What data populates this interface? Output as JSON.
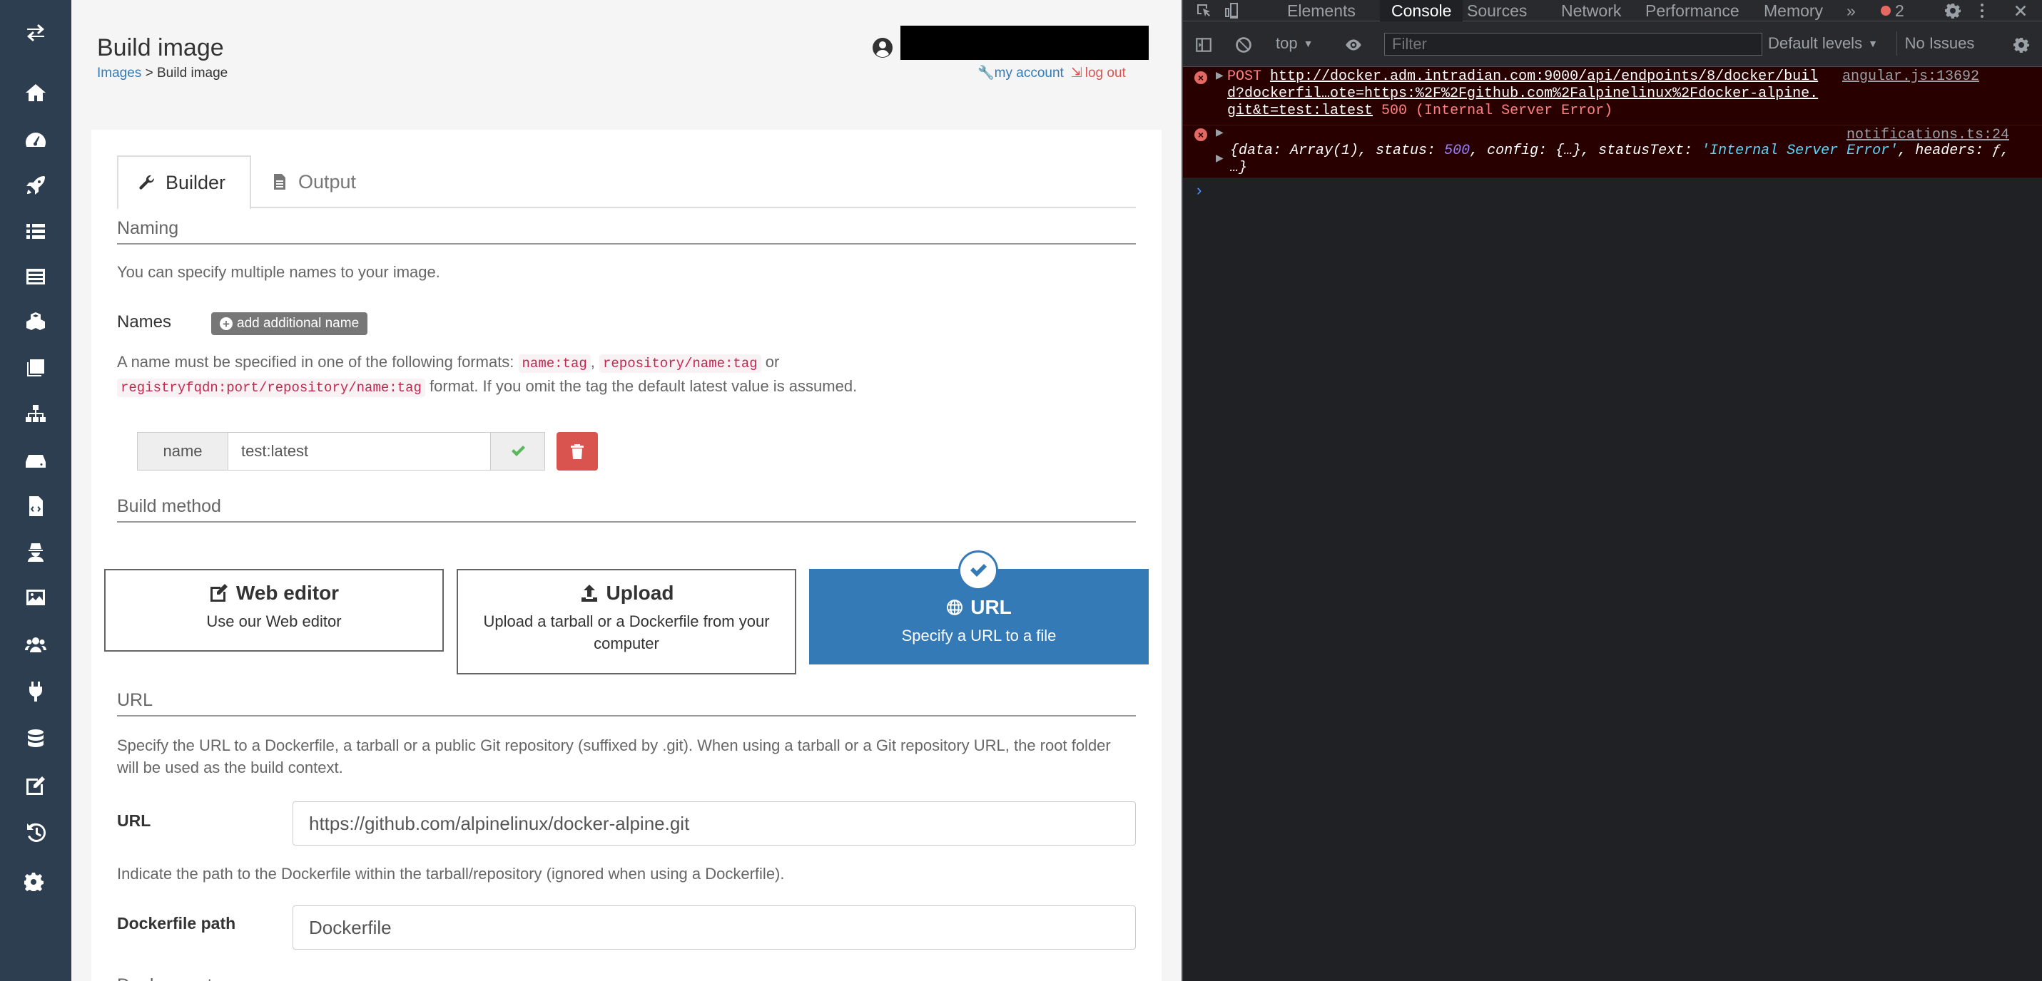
{
  "page": {
    "title": "Build image",
    "breadcrumb_parent": "Images",
    "breadcrumb_sep": " > ",
    "breadcrumb_current": "Build image"
  },
  "user": {
    "my_account": "my account",
    "log_out": "log out"
  },
  "sidebar": {
    "items": [
      {
        "icon": "home-icon"
      },
      {
        "icon": "dashboard-icon"
      },
      {
        "icon": "rocket-icon"
      },
      {
        "icon": "list-icon"
      },
      {
        "icon": "containers-icon"
      },
      {
        "icon": "cubes-icon"
      },
      {
        "icon": "images-icon"
      },
      {
        "icon": "sitemap-icon"
      },
      {
        "icon": "hdd-icon"
      },
      {
        "icon": "file-code-icon"
      },
      {
        "icon": "user-secret-icon"
      },
      {
        "icon": "image-icon"
      },
      {
        "icon": "users-icon"
      },
      {
        "icon": "plug-icon"
      },
      {
        "icon": "database-icon"
      },
      {
        "icon": "edit-icon"
      },
      {
        "icon": "history-icon"
      },
      {
        "icon": "cogs-icon"
      }
    ]
  },
  "tabs": {
    "builder": "Builder",
    "output": "Output"
  },
  "naming": {
    "title": "Naming",
    "help": "You can specify multiple names to your image.",
    "names_label": "Names",
    "add_button": "add additional name",
    "format_pre": "A name must be specified in one of the following formats: ",
    "format_code1": "name:tag",
    "format_sep1": ", ",
    "format_code2": "repository/name:tag",
    "format_or": " or ",
    "format_code3": "registryfqdn:port/repository/name:tag",
    "format_post": " format. If you omit the tag the default latest value is assumed.",
    "name_addon": "name",
    "name_value": "test:latest"
  },
  "build_method": {
    "title": "Build method",
    "web_title": "Web editor",
    "web_desc": "Use our Web editor",
    "upload_title": "Upload",
    "upload_desc": "Upload a tarball or a Dockerfile from your computer",
    "url_title": "URL",
    "url_desc": "Specify a URL to a file"
  },
  "url_section": {
    "title": "URL",
    "help": "Specify the URL to a Dockerfile, a tarball or a public Git repository (suffixed by .git). When using a tarball or a Git repository URL, the root folder will be used as the build context.",
    "url_label": "URL",
    "url_value": "https://github.com/alpinelinux/docker-alpine.git",
    "path_help": "Indicate the path to the Dockerfile within the tarball/repository (ignored when using a Dockerfile).",
    "path_label": "Dockerfile path",
    "path_value": "Dockerfile",
    "next_title": "Deployment"
  },
  "devtools": {
    "tabs": [
      "Elements",
      "Console",
      "Sources",
      "Network",
      "Performance",
      "Memory"
    ],
    "more": "»",
    "error_count": "2",
    "context": "top",
    "filter_placeholder": "Filter",
    "levels": "Default levels",
    "issues": "No Issues",
    "msg1": {
      "method": "POST ",
      "url": "http://docker.adm.intradian.com:9000/api/endpoints/8/docker/build?dockerfil…ote=https:%2F%2Fgithub.com%2Falpinelinux%2Fdocker-alpine.git&t=test:latest",
      "status": " 500 (Internal Server Error)",
      "source": "angular.js:13692"
    },
    "msg2": {
      "source": "notifications.ts:24",
      "p1": "{data: ",
      "p2": "Array(1)",
      "p3": ", status: ",
      "p4": "500",
      "p5": ", config: {…}, statusText: ",
      "p6": "'Internal Server Error'",
      "p7": ", headers: ƒ, …}"
    },
    "prompt": "›"
  },
  "colors": {
    "sidebar": "#2d3e50",
    "primary": "#337ab7",
    "danger": "#d9534f",
    "success": "#5cb85c"
  }
}
